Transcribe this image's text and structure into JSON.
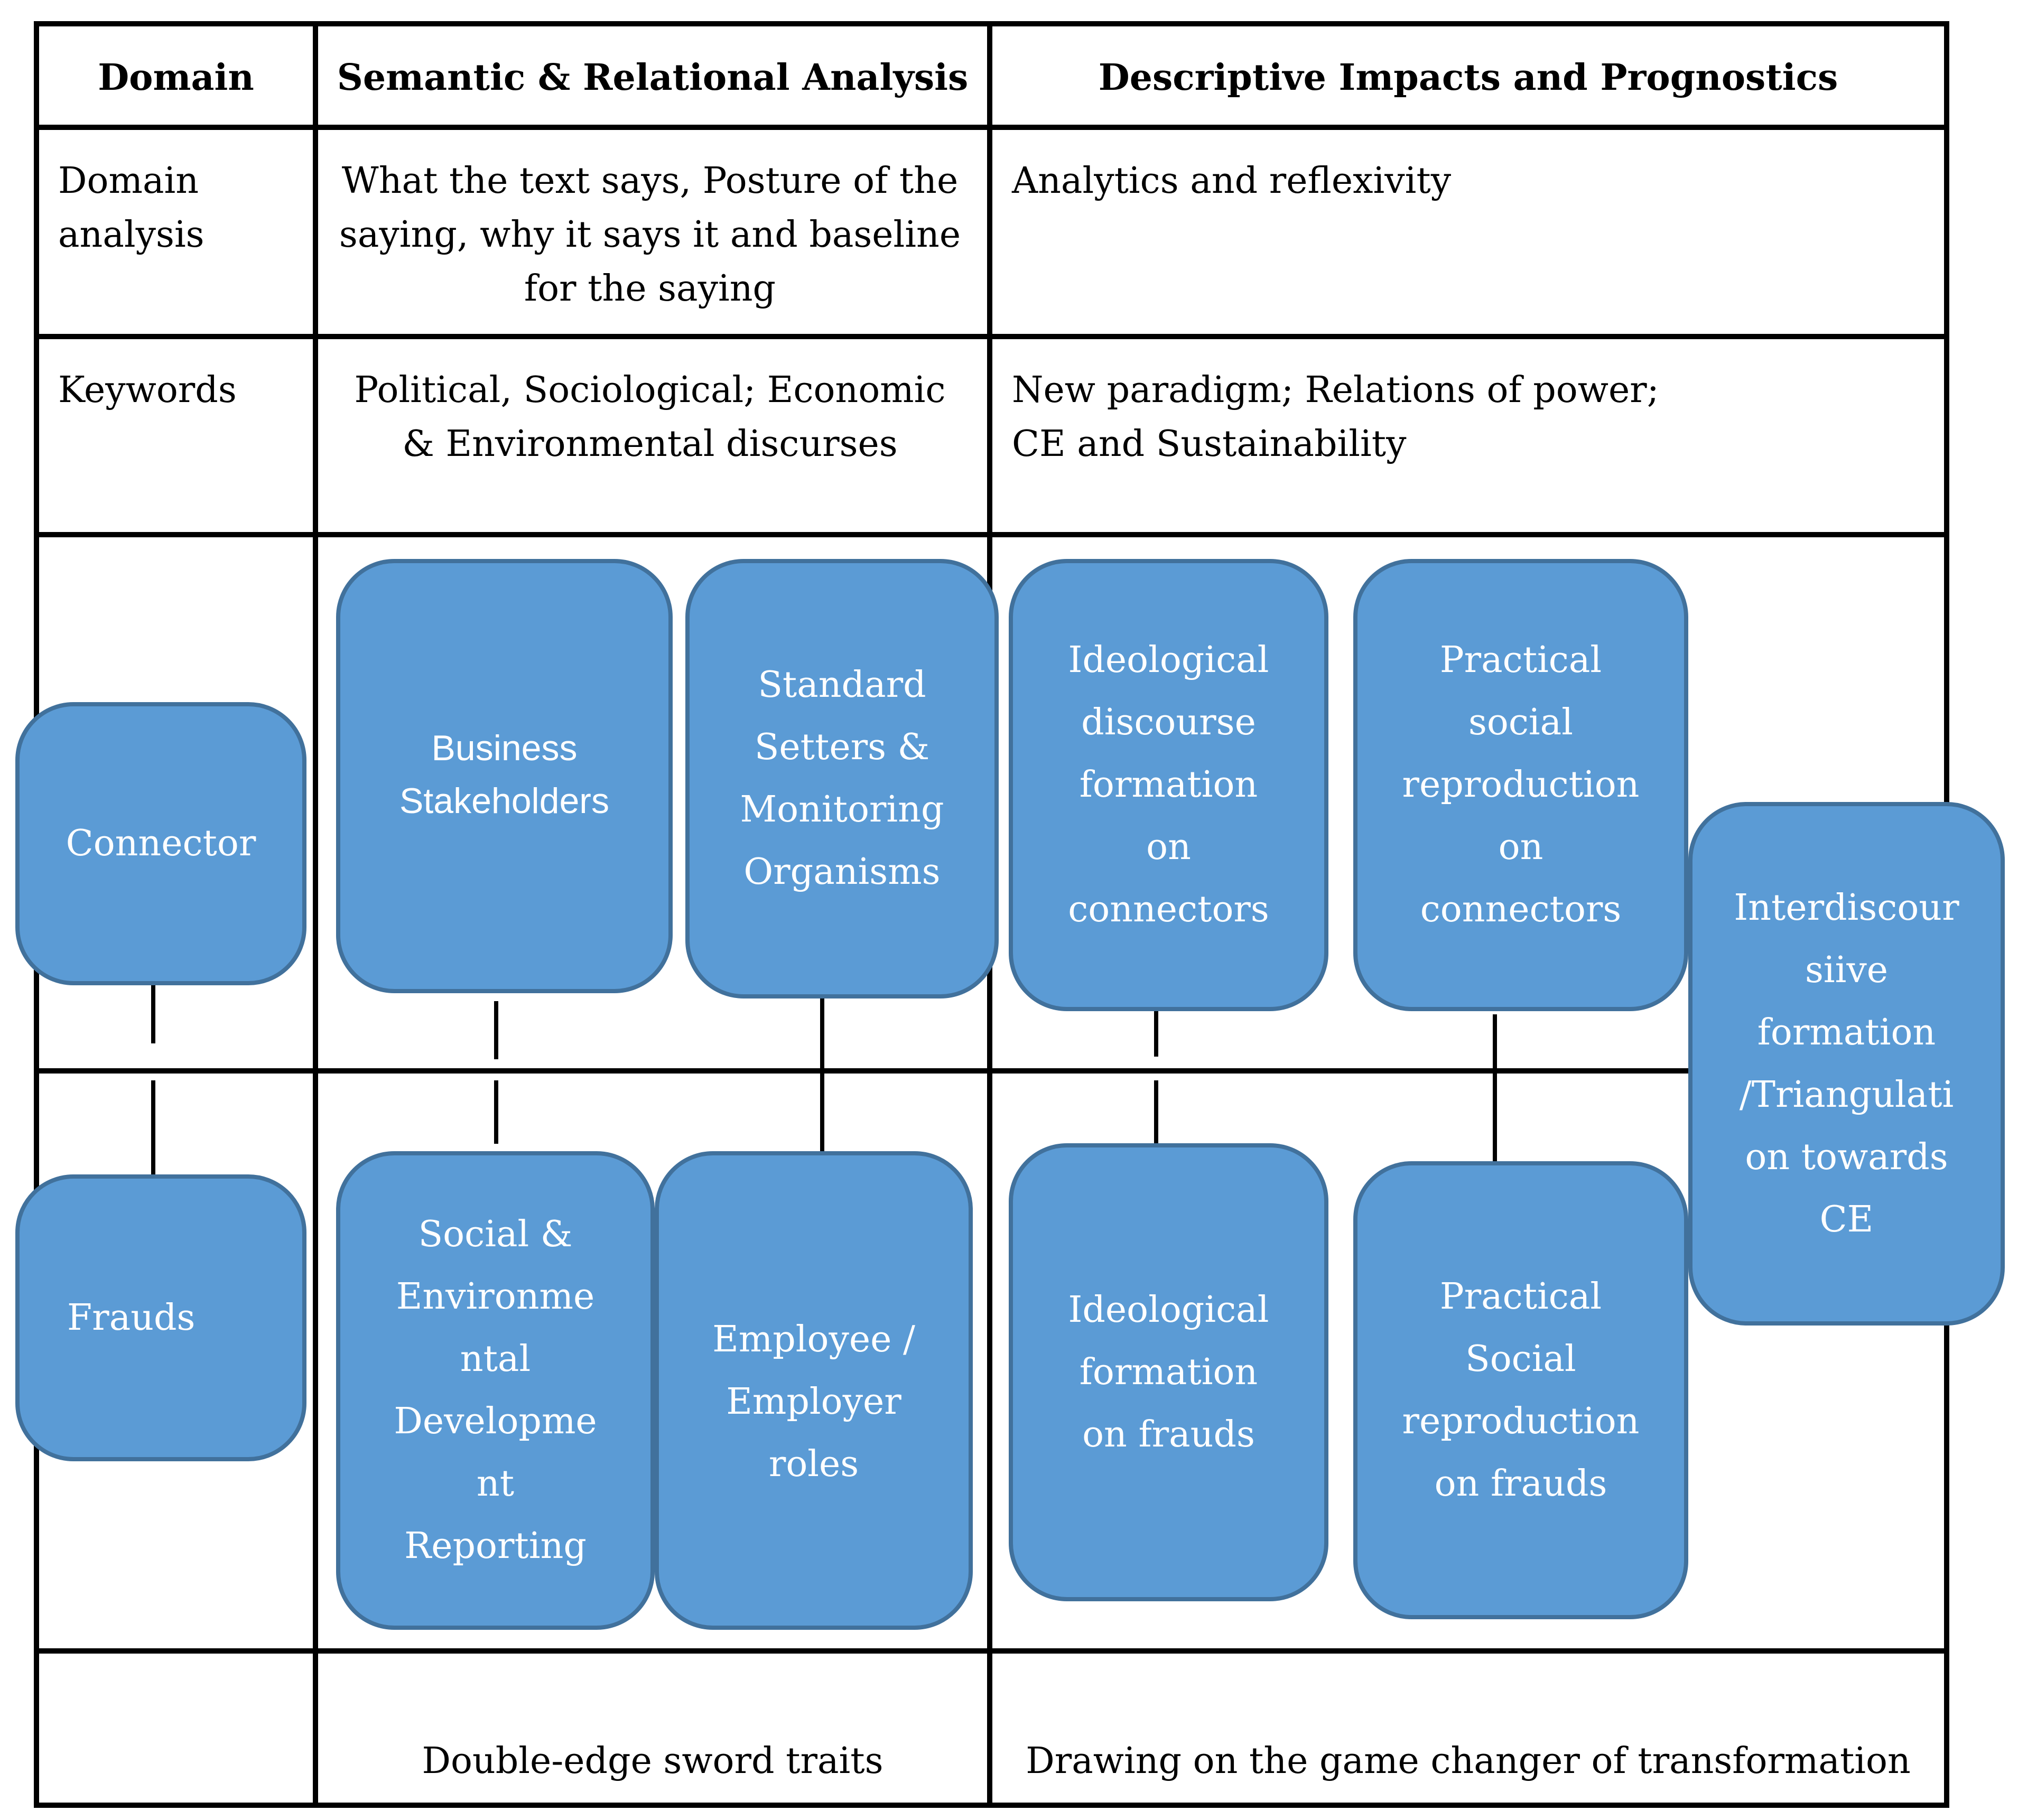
{
  "table": {
    "headers": [
      "Domain",
      "Semantic & Relational Analysis",
      "Descriptive Impacts and Prognostics"
    ],
    "rows": [
      {
        "label": "Domain\nanalysis",
        "semantic": "What the text says, Posture of the saying, why it says it and baseline for the saying",
        "descriptive": "Analytics and reflexivity"
      },
      {
        "label": "Keywords",
        "semantic": "Political, Sociological; Economic & Environmental discurses",
        "descriptive": "New paradigm; Relations of power;\nCE and Sustainability"
      }
    ],
    "footer": {
      "semantic": "Double-edge sword traits",
      "descriptive": "Drawing on the game changer of transformation"
    }
  },
  "boxes": {
    "connector": "Connector",
    "frauds": "Frauds",
    "business_stakeholders": "Business\nStakeholders",
    "standard_setters": "Standard\nSetters &\nMonitoring\nOrganisms",
    "social_env_reporting": "Social &\nEnvironme\nntal\nDevelopme\nnt\nReporting",
    "employee_employer": "Employee /\nEmployer\nroles",
    "ideological_connectors": "Ideological\ndiscourse\nformation\non\nconnectors",
    "practical_connectors": "Practical\nsocial\nreproduction\non\nconnectors",
    "interdiscursive": "Interdiscour\nsiive\nformation\n/Triangulati\non towards\nCE",
    "ideological_frauds": "Ideological\nformation\non frauds",
    "practical_frauds": "Practical\nSocial\nreproduction\non frauds"
  },
  "colors": {
    "box_fill": "#5b9bd5",
    "box_border": "#41719c",
    "box_text": "#ffffff",
    "grid": "#000000"
  }
}
